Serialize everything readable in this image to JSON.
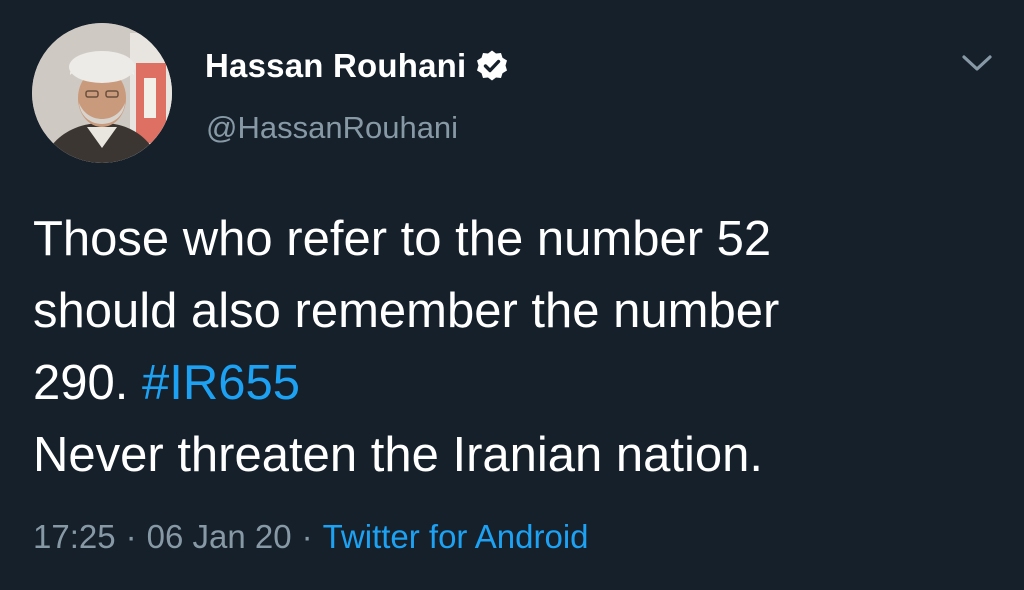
{
  "colors": {
    "background": "#15202b",
    "text_primary": "#ffffff",
    "text_secondary": "#8899a6",
    "accent": "#1da1f2"
  },
  "tweet": {
    "author": {
      "display_name": "Hassan Rouhani",
      "handle": "@HassanRouhani",
      "verified": true,
      "verified_icon": "verified-badge-icon",
      "avatar": "profile-photo"
    },
    "menu_icon": "chevron-down-icon",
    "body": {
      "line1": "Those who refer to the number 52",
      "line2": "should also remember the number",
      "line3_prefix": "290. ",
      "hashtag": "#IR655",
      "line4": "Never threaten the Iranian nation."
    },
    "meta": {
      "time": "17:25",
      "date": "06 Jan 20",
      "separator": "·",
      "source": "Twitter for Android"
    }
  }
}
